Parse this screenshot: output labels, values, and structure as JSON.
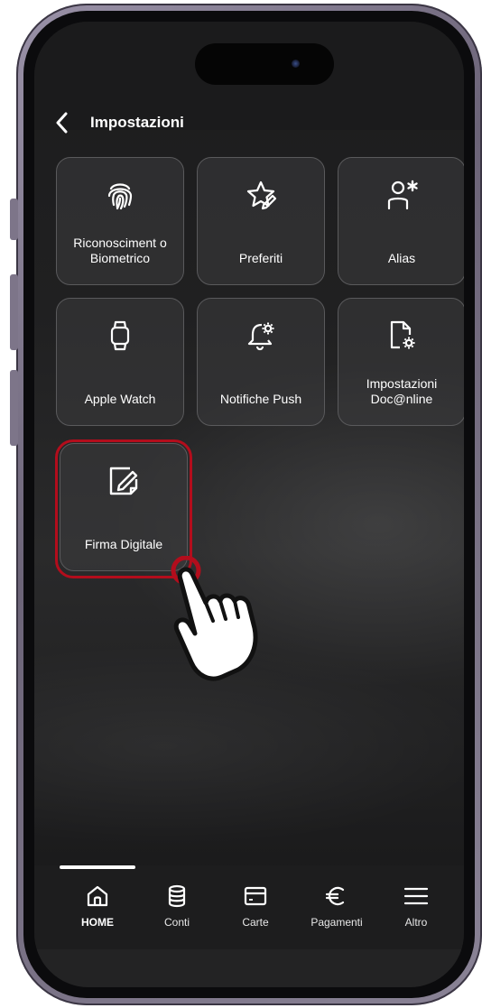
{
  "header": {
    "title": "Impostazioni"
  },
  "tiles": [
    {
      "label": "Riconosciment o Biometrico",
      "icon": "fingerprint-icon"
    },
    {
      "label": "Preferiti",
      "icon": "star-edit-icon"
    },
    {
      "label": "Alias",
      "icon": "user-asterisk-icon"
    },
    {
      "label": "Apple Watch",
      "icon": "watch-icon"
    },
    {
      "label": "Notifiche Push",
      "icon": "bell-gear-icon"
    },
    {
      "label": "Impostazioni Doc@nline",
      "icon": "document-gear-icon"
    },
    {
      "label": "Firma Digitale",
      "icon": "signature-edit-icon"
    }
  ],
  "nav": [
    {
      "label": "HOME",
      "icon": "home-icon",
      "active": true
    },
    {
      "label": "Conti",
      "icon": "database-icon"
    },
    {
      "label": "Carte",
      "icon": "card-icon"
    },
    {
      "label": "Pagamenti",
      "icon": "euro-icon"
    },
    {
      "label": "Altro",
      "icon": "menu-icon"
    }
  ],
  "colors": {
    "highlight": "#b30d1c",
    "tile_border": "#5a5a5c",
    "background": "#1e1e1f"
  }
}
